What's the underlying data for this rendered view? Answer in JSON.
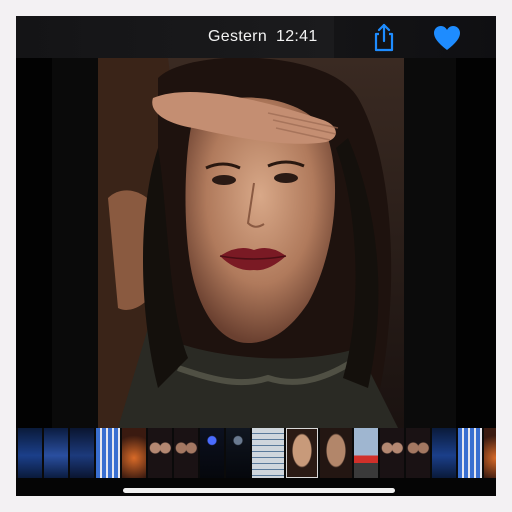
{
  "header": {
    "date": "Gestern",
    "time": "12:41"
  },
  "icons": {
    "share": "share-icon",
    "favorite": "heart-icon"
  },
  "colors": {
    "accent": "#1e8cff",
    "background": "#050505",
    "text": "#f2f2f2"
  },
  "filmstrip": {
    "items": [
      {
        "kind": "blue-screen",
        "colors": [
          "#0a1a3a",
          "#1b3f8a"
        ]
      },
      {
        "kind": "blue-screen",
        "colors": [
          "#0b1c40",
          "#2a4fa0"
        ]
      },
      {
        "kind": "blue-screen",
        "colors": [
          "#0a1530",
          "#1c3a7c"
        ]
      },
      {
        "kind": "app-grid",
        "colors": [
          "#3a6fd0",
          "#e7e7ee"
        ]
      },
      {
        "kind": "wallpaper",
        "colors": [
          "#3a1a10",
          "#d86a28"
        ]
      },
      {
        "kind": "portrait-pair",
        "colors": [
          "#1a1214",
          "#b48872"
        ]
      },
      {
        "kind": "portrait-pair",
        "colors": [
          "#1a1214",
          "#a47862"
        ]
      },
      {
        "kind": "dark-ui",
        "colors": [
          "#0c1120",
          "#4a6cff"
        ]
      },
      {
        "kind": "dark-ui",
        "colors": [
          "#101620",
          "#6a7a90"
        ]
      },
      {
        "kind": "document",
        "colors": [
          "#cfd6dc",
          "#5a7a9a"
        ]
      },
      {
        "kind": "portrait",
        "colors": [
          "#2a1a14",
          "#c89a7a"
        ],
        "selected": true
      },
      {
        "kind": "portrait",
        "colors": [
          "#231612",
          "#b2866a"
        ]
      },
      {
        "kind": "street",
        "colors": [
          "#9fb6d0",
          "#d0302a"
        ]
      },
      {
        "kind": "portrait-pair",
        "colors": [
          "#1a1214",
          "#b48872"
        ]
      },
      {
        "kind": "portrait-pair",
        "colors": [
          "#1a1214",
          "#a47862"
        ]
      },
      {
        "kind": "blue-screen",
        "colors": [
          "#0a1a3a",
          "#1b3f8a"
        ]
      },
      {
        "kind": "app-grid",
        "colors": [
          "#3a6fd0",
          "#e7e7ee"
        ]
      },
      {
        "kind": "wallpaper",
        "colors": [
          "#3a1a10",
          "#d86a28"
        ]
      },
      {
        "kind": "portrait-pair",
        "colors": [
          "#1a1214",
          "#b48872"
        ]
      },
      {
        "kind": "blue-screen",
        "colors": [
          "#0b1c40",
          "#2a4fa0"
        ]
      },
      {
        "kind": "blue-screen",
        "colors": [
          "#0a1530",
          "#1c3a7c"
        ]
      }
    ]
  }
}
